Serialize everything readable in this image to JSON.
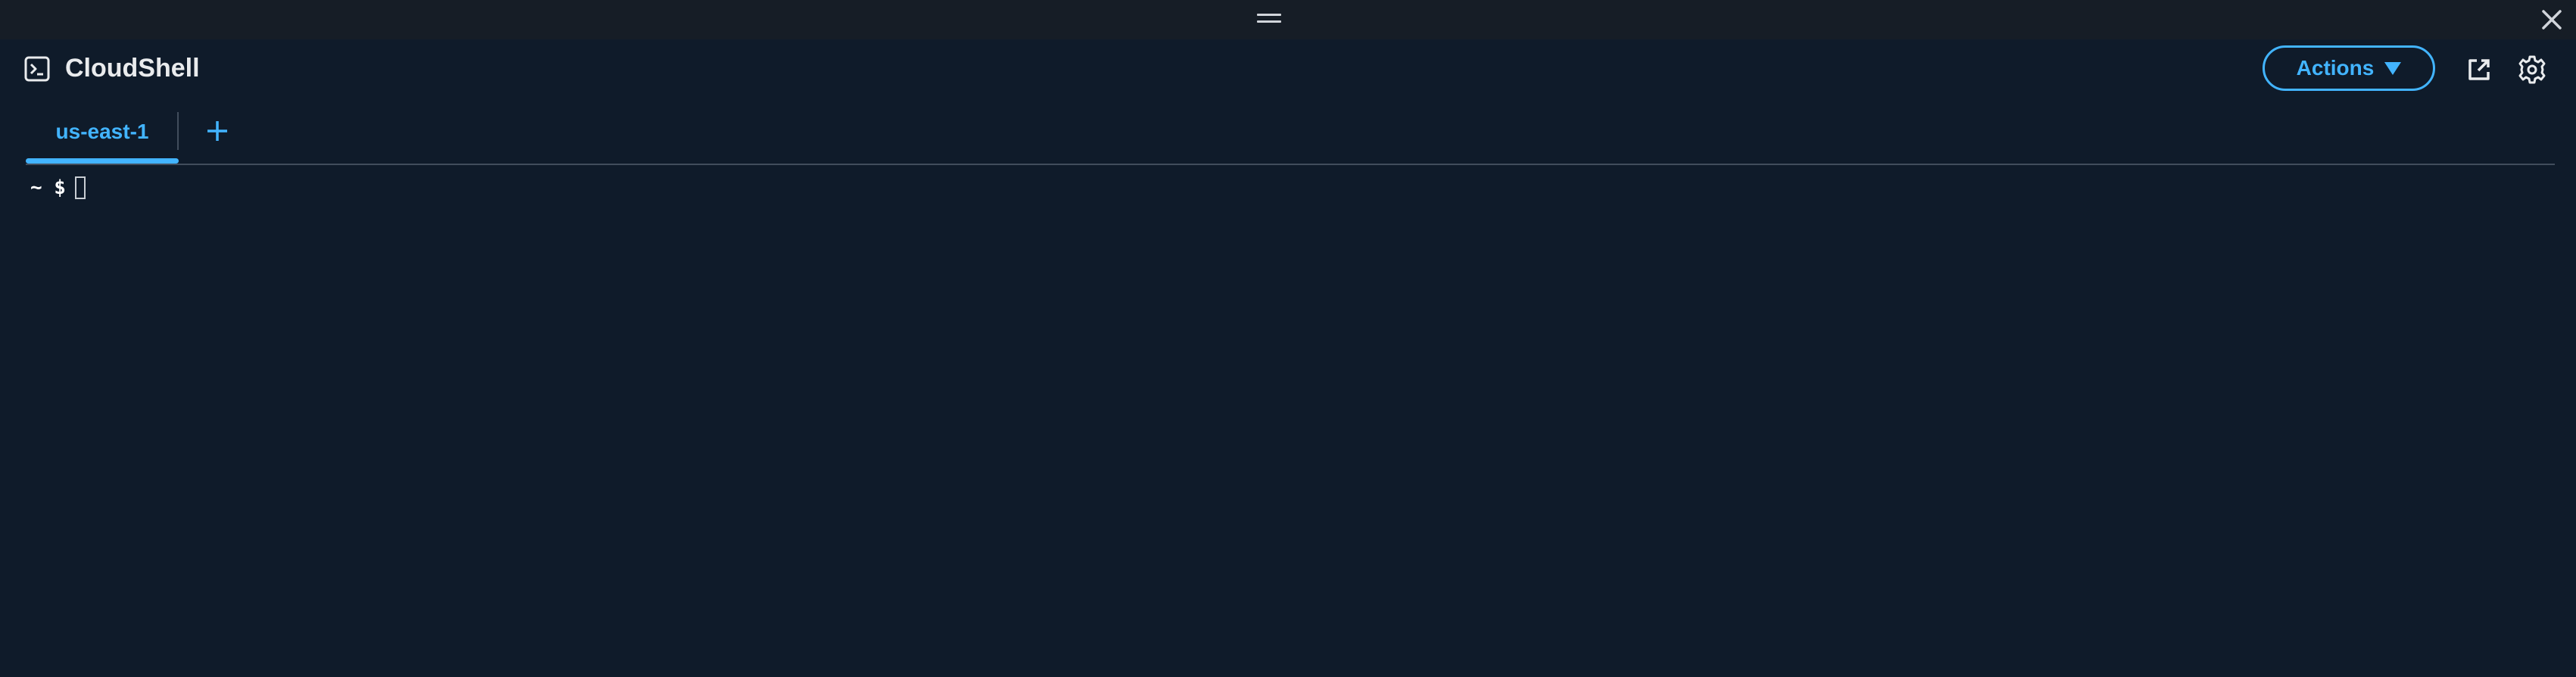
{
  "window": {
    "close_icon": "close-icon",
    "drag_icon": "drag-handle-icon"
  },
  "header": {
    "title": "CloudShell",
    "title_icon": "terminal-icon",
    "actions_label": "Actions",
    "actions_icon": "caret-down-icon",
    "open_new_tab_icon": "external-link-icon",
    "settings_icon": "gear-icon"
  },
  "tabs": {
    "items": [
      {
        "label": "us-east-1",
        "active": true
      }
    ],
    "add_icon": "plus-icon"
  },
  "terminal": {
    "prompt": "~ $"
  },
  "colors": {
    "background": "#0f1b2a",
    "top_strip": "#161d26",
    "accent": "#42b4ff",
    "text": "#e9ebed",
    "divider": "#414d5c"
  }
}
